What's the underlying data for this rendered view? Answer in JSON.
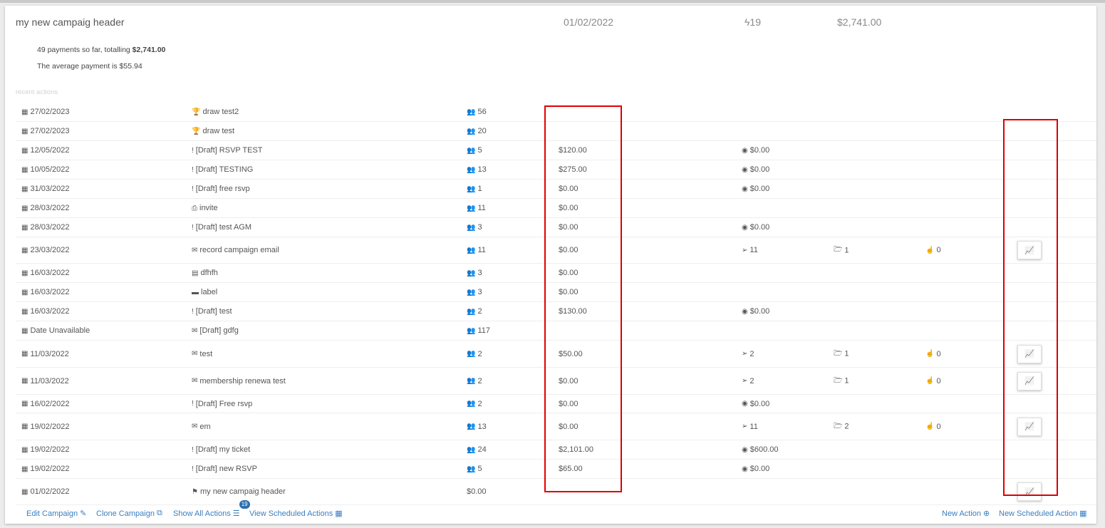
{
  "header": {
    "title": "my new campaig header",
    "date": "01/02/2022",
    "count": "19",
    "amount": "$2,741.00"
  },
  "summary": {
    "payments_prefix": "49 payments so far, totalling ",
    "payments_total": "$2,741.00",
    "average": "The average payment is $55.94"
  },
  "recent_label": "recent actions",
  "rows": [
    {
      "date": "27/02/2023",
      "name": "draw test2",
      "people": "56",
      "amount": "",
      "extra": "",
      "opens": "",
      "clicks": ""
    },
    {
      "date": "27/02/2023",
      "name": "draw test",
      "people": "20",
      "amount": "",
      "extra": "",
      "opens": "",
      "clicks": ""
    },
    {
      "date": "12/05/2022",
      "name": "[Draft] RSVP TEST",
      "people": "5",
      "amount": "$120.00",
      "extra": "$0.00",
      "opens": "",
      "clicks": ""
    },
    {
      "date": "10/05/2022",
      "name": "[Draft] TESTING",
      "people": "13",
      "amount": "$275.00",
      "extra": "$0.00",
      "opens": "",
      "clicks": ""
    },
    {
      "date": "31/03/2022",
      "name": "[Draft] free rsvp",
      "people": "1",
      "amount": "$0.00",
      "extra": "$0.00",
      "opens": "",
      "clicks": ""
    },
    {
      "date": "28/03/2022",
      "name": "invite",
      "people": "11",
      "amount": "$0.00",
      "extra": "",
      "opens": "",
      "clicks": ""
    },
    {
      "date": "28/03/2022",
      "name": "[Draft] test AGM",
      "people": "3",
      "amount": "$0.00",
      "extra": "$0.00",
      "opens": "",
      "clicks": ""
    },
    {
      "date": "23/03/2022",
      "name": "record campaign email",
      "people": "11",
      "amount": "$0.00",
      "extra": "11",
      "opens": "1",
      "clicks": "0"
    },
    {
      "date": "16/03/2022",
      "name": "dfhfh",
      "people": "3",
      "amount": "$0.00",
      "extra": "",
      "opens": "",
      "clicks": ""
    },
    {
      "date": "16/03/2022",
      "name": "label",
      "people": "3",
      "amount": "$0.00",
      "extra": "",
      "opens": "",
      "clicks": ""
    },
    {
      "date": "16/03/2022",
      "name": "[Draft] test",
      "people": "2",
      "amount": "$130.00",
      "extra": "$0.00",
      "opens": "",
      "clicks": ""
    },
    {
      "date": "Date Unavailable",
      "name": "[Draft] gdfg",
      "people": "117",
      "amount": "",
      "extra": "",
      "opens": "",
      "clicks": ""
    },
    {
      "date": "11/03/2022",
      "name": "test",
      "people": "2",
      "amount": "$50.00",
      "extra": "2",
      "opens": "1",
      "clicks": "0"
    },
    {
      "date": "11/03/2022",
      "name": "membership renewa test",
      "people": "2",
      "amount": "$0.00",
      "extra": "2",
      "opens": "1",
      "clicks": "0"
    },
    {
      "date": "16/02/2022",
      "name": "[Draft] Free rsvp",
      "people": "2",
      "amount": "$0.00",
      "extra": "$0.00",
      "opens": "",
      "clicks": ""
    },
    {
      "date": "19/02/2022",
      "name": "em",
      "people": "13",
      "amount": "$0.00",
      "extra": "11",
      "opens": "2",
      "clicks": "0"
    },
    {
      "date": "19/02/2022",
      "name": "[Draft] my ticket",
      "people": "24",
      "amount": "$2,101.00",
      "extra": "$600.00",
      "opens": "",
      "clicks": ""
    },
    {
      "date": "19/02/2022",
      "name": "[Draft] new RSVP",
      "people": "5",
      "amount": "$65.00",
      "extra": "$0.00",
      "opens": "",
      "clicks": ""
    },
    {
      "date": "01/02/2022",
      "name": "my new campaig header",
      "people": "$0.00",
      "amount": "",
      "extra": "",
      "opens": "",
      "clicks": ""
    }
  ],
  "row_types": [
    "trophy",
    "trophy",
    "draft",
    "draft",
    "draft",
    "pdf",
    "draft",
    "email",
    "excel",
    "label",
    "draft",
    "email",
    "email",
    "email",
    "draft",
    "email",
    "draft",
    "draft",
    "flag"
  ],
  "footer": {
    "edit": "Edit Campaign",
    "clone": "Clone Campaign",
    "show_all": "Show All Actions",
    "show_all_badge": "19",
    "view_scheduled": "View Scheduled Actions",
    "new_action": "New Action",
    "new_scheduled": "New Scheduled Action"
  },
  "colors": {
    "link": "#3a7fc1",
    "highlight": "#e00000"
  }
}
